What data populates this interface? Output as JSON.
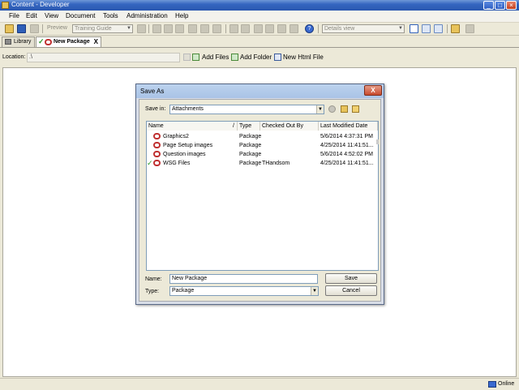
{
  "window": {
    "title": "Content - Developer"
  },
  "menu": [
    "File",
    "Edit",
    "View",
    "Document",
    "Tools",
    "Administration",
    "Help"
  ],
  "toolbar": {
    "preview_label": "Preview",
    "guide_select": "Training Guide",
    "view_select": "Details view"
  },
  "tabs": [
    {
      "label": "Library"
    },
    {
      "label": "New Package",
      "close": "X"
    }
  ],
  "location": {
    "label": "Location:",
    "value": ".\\",
    "add_files": "Add Files",
    "add_folder": "Add Folder",
    "new_html": "New Html File"
  },
  "status": {
    "online": "Online"
  },
  "dialog": {
    "title": "Save As",
    "close": "X",
    "save_in_label": "Save in:",
    "save_in_value": "Attachments",
    "columns": [
      "Name",
      "/",
      "Type",
      "Checked Out By",
      "Last Modified Date"
    ],
    "rows": [
      {
        "name": "Graphics2",
        "type": "Package",
        "checked_out_by": "",
        "date": "5/6/2014 4:37:31 PM",
        "checked": false
      },
      {
        "name": "Page Setup images",
        "type": "Package",
        "checked_out_by": "",
        "date": "4/25/2014 11:41:51...",
        "checked": false
      },
      {
        "name": "Question images",
        "type": "Package",
        "checked_out_by": "",
        "date": "5/6/2014 4:52:02 PM",
        "checked": false
      },
      {
        "name": "WSG Files",
        "type": "Package",
        "checked_out_by": "THandsom",
        "date": "4/25/2014 11:41:51...",
        "checked": true
      }
    ],
    "name_label": "Name:",
    "name_value": "New Package",
    "type_label": "Type:",
    "type_value": "Package",
    "save_button": "Save",
    "cancel_button": "Cancel"
  },
  "colors": {
    "titlebar": "#2a57b0",
    "dialog_title": "#a9c3e6",
    "close_red": "#c84a2e",
    "check_green": "#2a9a2a",
    "package_red": "#c03030"
  }
}
